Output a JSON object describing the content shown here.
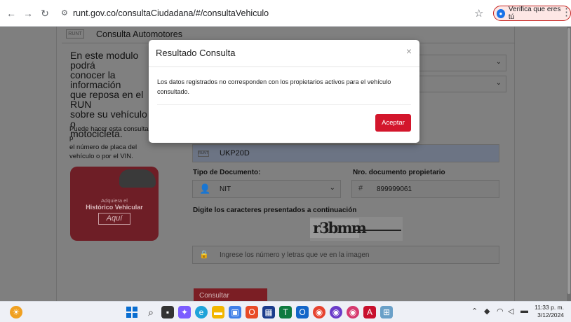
{
  "browser": {
    "url": "runt.gov.co/consultaCiudadana/#/consultaVehiculo",
    "verify_label": "Verifica que eres tú"
  },
  "page": {
    "header_logo": "RUNT",
    "header_title": "Consulta Automotores",
    "intro_lines": [
      "En este modulo podrá",
      "conocer la información",
      "que reposa en el RUN",
      "sobre su vehículo o",
      "motocicleta."
    ],
    "side_lines": [
      "Puede hacer esta consulta p",
      "el número de placa del",
      "vehículo o por el VIN."
    ],
    "promo": {
      "line1": "Adquiera el",
      "line2": "Histórico Vehicular",
      "button": "Aquí"
    },
    "plate_tag": "RUNT",
    "plate_value": "UKP20D",
    "doc_type_label": "Tipo de Documento:",
    "doc_type_value": "NIT",
    "doc_number_label": "Nro. documento propietario",
    "doc_number_value": "899999061",
    "captcha_label": "Digite los caracteres presentados a continuación",
    "captcha_text": "r3bmm",
    "captcha_placeholder": "Ingrese los número y letras que ve en la imagen",
    "submit_label": "Consultar Información"
  },
  "modal": {
    "title": "Resultado Consulta",
    "close": "×",
    "body": "Los datos registrados no corresponden con los propietarios activos para el vehículo consultado.",
    "accept": "Aceptar"
  },
  "taskbar": {
    "time": "11:33 p. m.",
    "date": "3/12/2024"
  },
  "colors": {
    "accent_red": "#d3162c",
    "verify_border": "#c5221f"
  }
}
